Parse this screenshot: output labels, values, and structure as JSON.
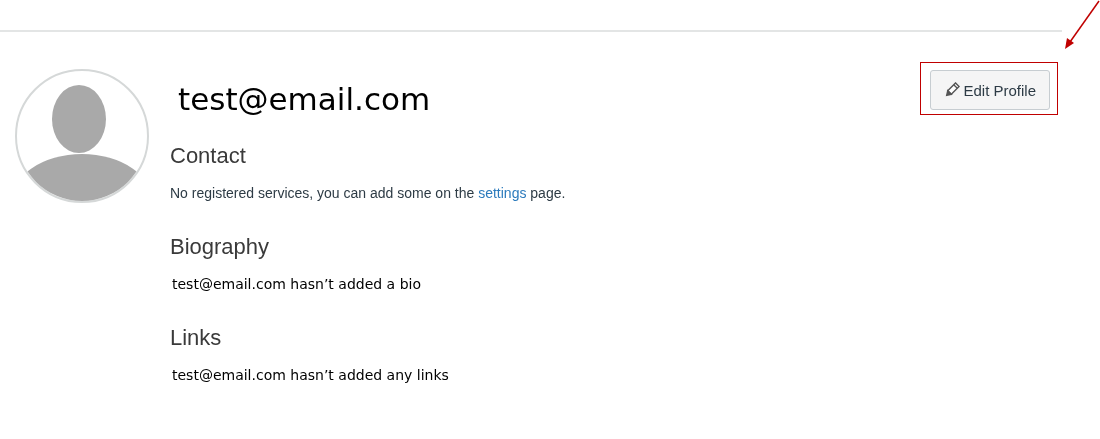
{
  "profile": {
    "name": "test@email.com",
    "edit_button": {
      "label": "Edit Profile"
    }
  },
  "sections": [
    {
      "kind": "contact",
      "heading": "Contact",
      "text_before": "No registered services, you can add some on the ",
      "link": "settings",
      "text_after": " page."
    },
    {
      "kind": "plain",
      "heading": "Biography",
      "text": "test@email.com hasn’t added a bio"
    },
    {
      "kind": "plain",
      "heading": "Links",
      "text": "test@email.com hasn’t added any links"
    }
  ]
}
